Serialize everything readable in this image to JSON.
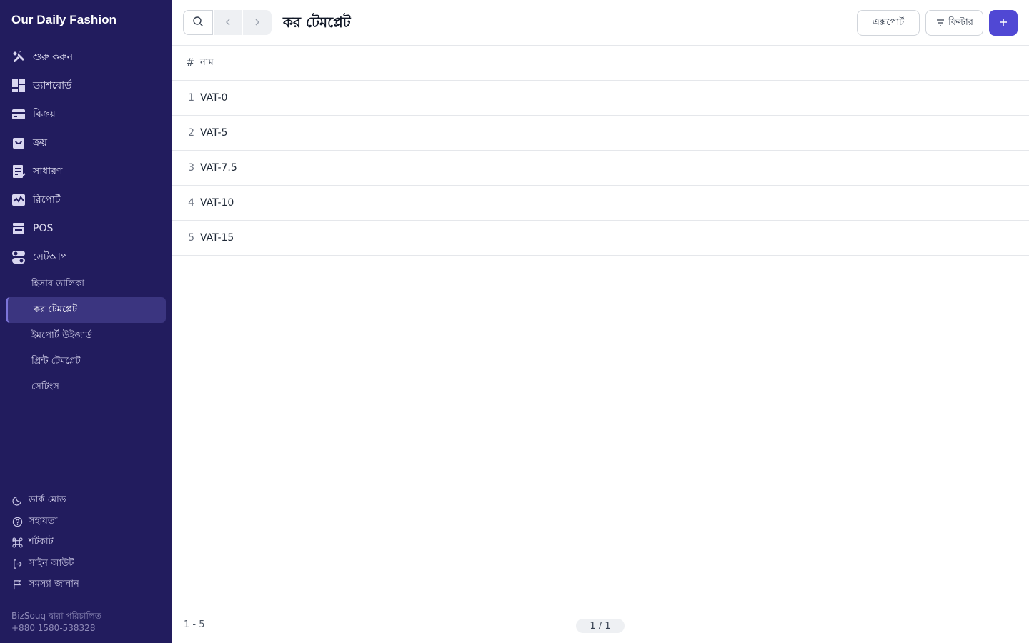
{
  "brand": "Our Daily Fashion",
  "sidebar": {
    "items": [
      {
        "label": "শুরু করুন",
        "icon": "tools-icon"
      },
      {
        "label": "ড্যাশবোর্ড",
        "icon": "dashboard-icon"
      },
      {
        "label": "বিক্রয়",
        "icon": "card-icon"
      },
      {
        "label": "ক্রয়",
        "icon": "shopping-bag-icon"
      },
      {
        "label": "সাধারণ",
        "icon": "journal-icon"
      },
      {
        "label": "রিপোর্ট",
        "icon": "chart-icon"
      },
      {
        "label": "POS",
        "icon": "pos-icon"
      },
      {
        "label": "সেটআপ",
        "icon": "toggle-icon"
      }
    ],
    "sub_items": [
      {
        "label": "হিসাব তালিকা",
        "active": false
      },
      {
        "label": "কর টেমপ্লেট",
        "active": true
      },
      {
        "label": "ইমপোর্ট উইজার্ড",
        "active": false
      },
      {
        "label": "প্রিন্ট টেমপ্লেট",
        "active": false
      },
      {
        "label": "সেটিংস",
        "active": false
      }
    ],
    "bottom_links": [
      {
        "label": "ডার্ক মোড",
        "icon": "moon-icon"
      },
      {
        "label": "সহায়তা",
        "icon": "help-icon"
      },
      {
        "label": "শর্টকাট",
        "icon": "command-icon"
      },
      {
        "label": "সাইন আউট",
        "icon": "sign-out-icon"
      },
      {
        "label": "সমস্যা জানান",
        "icon": "flag-icon"
      }
    ],
    "footer_line1": "BizSouq দ্বারা পরিচালিত",
    "footer_line2": "+880 1580-538328"
  },
  "header": {
    "title": "কর টেমপ্লেট",
    "export_label": "এক্সপোর্ট",
    "filter_label": "ফিল্টার"
  },
  "table": {
    "col_index": "#",
    "col_name": "নাম",
    "rows": [
      {
        "index": "1",
        "name": "VAT-0"
      },
      {
        "index": "2",
        "name": "VAT-5"
      },
      {
        "index": "3",
        "name": "VAT-7.5"
      },
      {
        "index": "4",
        "name": "VAT-10"
      },
      {
        "index": "5",
        "name": "VAT-15"
      }
    ]
  },
  "pager": {
    "range": "1 - 5",
    "page": "1 / 1"
  },
  "colors": {
    "sidebar_bg": "#221c5e",
    "accent": "#5048d4"
  }
}
